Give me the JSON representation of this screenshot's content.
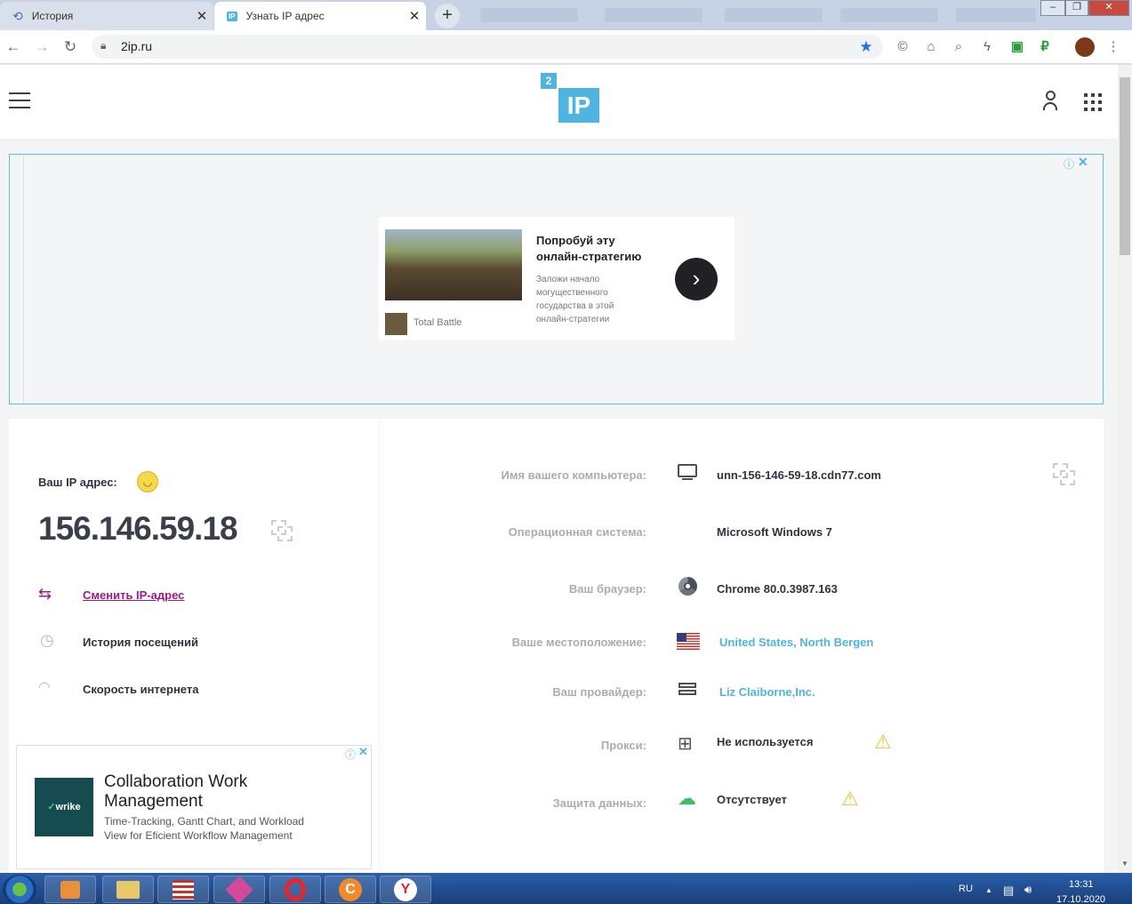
{
  "browser": {
    "tabs": [
      {
        "title": "История",
        "close": "✕"
      },
      {
        "title": "Узнать IP адрес",
        "close": "✕"
      }
    ],
    "new_tab": "+",
    "url": "2ip.ru",
    "window_buttons": [
      "–",
      "❐",
      "✕"
    ]
  },
  "site": {
    "logo_top": "2",
    "logo_main": "IP"
  },
  "ad_top": {
    "title": "Попробуй эту онлайн-стратегию",
    "description": "Заложи начало могущественного государства в этой онлайн-стратегии",
    "advertiser": "Total Battle"
  },
  "ip_panel": {
    "label": "Ваш IP адрес:",
    "ip": "156.146.59.18",
    "menu": [
      {
        "label": "Сменить IP-адрес",
        "link": true
      },
      {
        "label": "История посещений",
        "link": false
      },
      {
        "label": "Скорость интернета",
        "link": false
      }
    ]
  },
  "ad_bottom": {
    "brand": "wrike",
    "title": "Collaboration Work Management",
    "text": "Time-Tracking, Gantt Chart, and Workload View for Eficient Workflow Management"
  },
  "info": [
    {
      "label": "Имя вашего компьютера:",
      "value": "unn-156-146-59-18.cdn77.com",
      "icon": "monitor-icon",
      "link": false
    },
    {
      "label": "Операционная система:",
      "value": "Microsoft Windows 7",
      "icon": "",
      "link": false
    },
    {
      "label": "Ваш браузер:",
      "value": "Chrome 80.0.3987.163",
      "icon": "chrome-icon",
      "link": false
    },
    {
      "label": "Ваше местоположение:",
      "value": "United States, North Bergen",
      "icon": "us-flag-icon",
      "link": true
    },
    {
      "label": "Ваш провайдер:",
      "value": "Liz Claiborne,Inc.",
      "icon": "server-icon",
      "link": true
    },
    {
      "label": "Прокси:",
      "value": "Не используется",
      "icon": "network-icon",
      "link": false,
      "warning": true
    },
    {
      "label": "Защита данных:",
      "value": "Отсутствует",
      "icon": "cloud-lock-icon",
      "link": false,
      "warning": true
    }
  ],
  "taskbar": {
    "lang": "RU",
    "time": "13:31",
    "date": "17.10.2020"
  },
  "colors": {
    "accent": "#4fb5e0",
    "link_purple": "#9b1a8a",
    "warning": "#e8c33a",
    "text_dark": "#2e3340"
  }
}
